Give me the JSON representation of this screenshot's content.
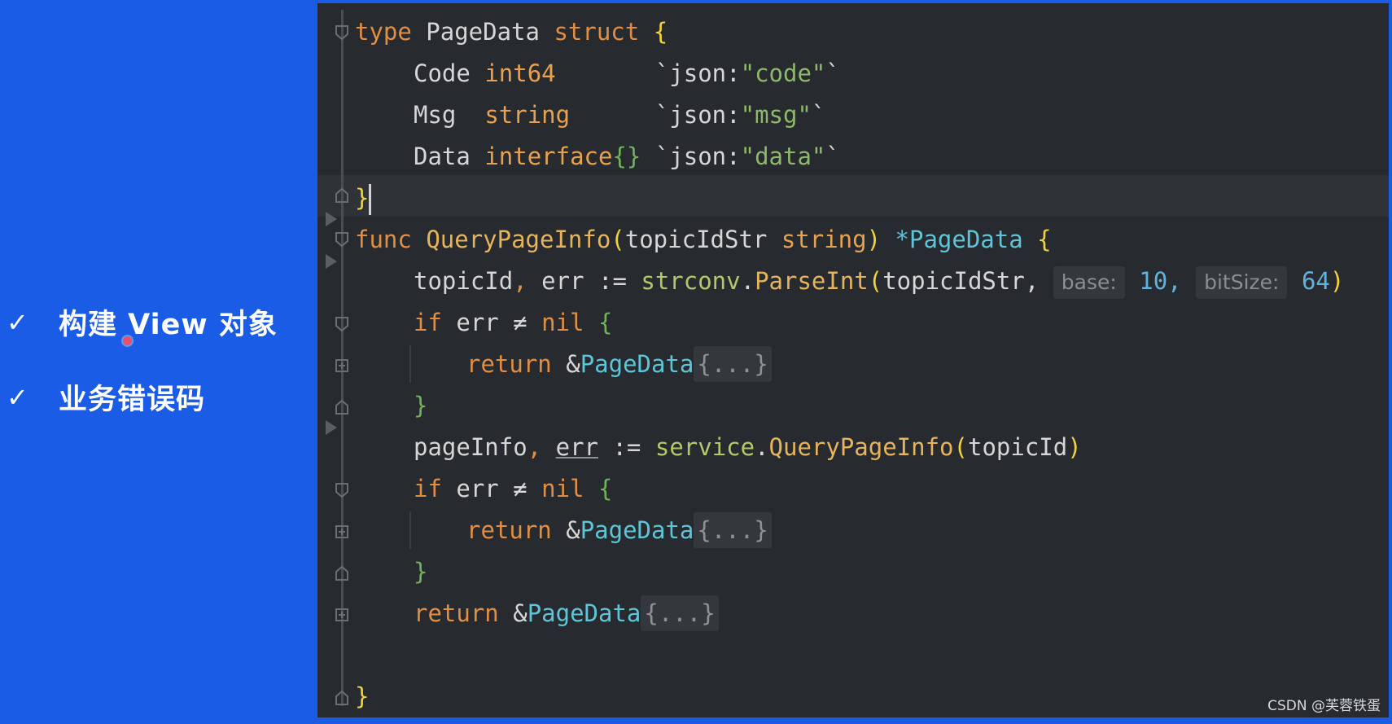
{
  "slide": {
    "bullets": [
      {
        "check": "✓",
        "text": "构建 View 对象"
      },
      {
        "check": "✓",
        "text": "业务错误码"
      }
    ]
  },
  "code": {
    "line1": {
      "kw": "type",
      "name": " PageData ",
      "kw2": "struct",
      "brace": "{"
    },
    "line2": {
      "field": "Code",
      "type": "int64",
      "tag_a": "`json:",
      "tag_v": "\"code\"",
      "tag_b": "`"
    },
    "line3": {
      "field": "Msg",
      "type": "string",
      "tag_a": "`json:",
      "tag_v": "\"msg\"",
      "tag_b": "`"
    },
    "line4": {
      "field": "Data",
      "type": "interface",
      "braces": "{}",
      "tag_a": "`json:",
      "tag_v": "\"data\"",
      "tag_b": "`"
    },
    "line5": {
      "brace": "}"
    },
    "line6": {
      "kw": "func",
      "fname": "QueryPageInfo",
      "p_open": "(",
      "param": "topicIdStr ",
      "ptype": "string",
      "p_close": ")",
      "ret": " *PageData",
      "brace": "{"
    },
    "line7": {
      "a": "topicId",
      "comma": ",",
      "b": " err := ",
      "pkg": "strconv",
      "dot": ".",
      "fn": "ParseInt",
      "open": "(",
      "arg": "topicIdStr,",
      "hint1": "base:",
      "v1": "10,",
      "hint2": "bitSize:",
      "v2": "64",
      "close": ")"
    },
    "line8": {
      "kw": "if",
      "mid": " err ≠ ",
      "nil": "nil",
      "brace": "{"
    },
    "line9": {
      "kw": "return",
      "amp": " &",
      "type": "PageData",
      "fold": "{...}"
    },
    "line10": {
      "brace": "}"
    },
    "line11": {
      "a": "pageInfo",
      "comma": ",",
      "sp": " ",
      "err": "err",
      "assign": " := ",
      "pkg": "service",
      "dot": ".",
      "fn": "QueryPageInfo",
      "open": "(",
      "arg": "topicId",
      "close": ")"
    },
    "line12": {
      "kw": "if",
      "mid": " err ≠ ",
      "nil": "nil",
      "brace": "{"
    },
    "line13": {
      "kw": "return",
      "amp": " &",
      "type": "PageData",
      "fold": "{...}"
    },
    "line14": {
      "brace": "}"
    },
    "line15": {
      "kw": "return",
      "amp": " &",
      "type": "PageData",
      "fold": "{...}"
    },
    "line16": {
      "brace": "}"
    }
  },
  "watermark": "CSDN @芙蓉铁蛋"
}
